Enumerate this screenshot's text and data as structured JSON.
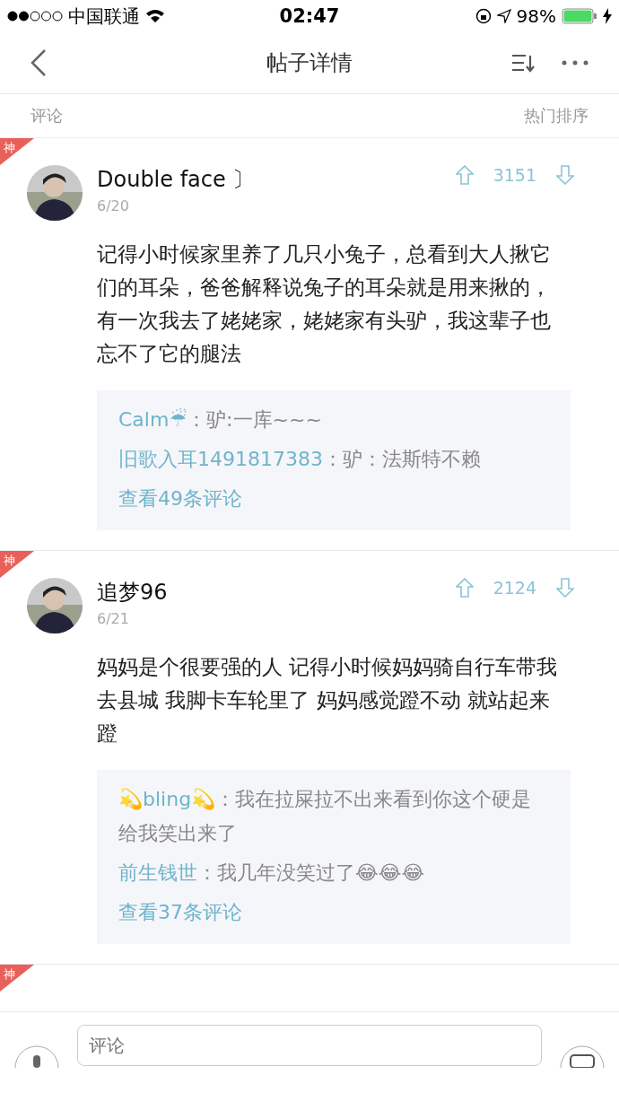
{
  "status_bar": {
    "carrier": "中国联通",
    "time": "02:47",
    "battery": "98%"
  },
  "nav": {
    "title": "帖子详情"
  },
  "section": {
    "title": "评论",
    "sort": "热门排序"
  },
  "comments": [
    {
      "badge": "神",
      "author": "Double  face 〕",
      "date": "6/20",
      "votes": "3151",
      "text": "记得小时候家里养了几只小兔子，总看到大人揪它们的耳朵，爸爸解释说兔子的耳朵就是用来揪的，有一次我去了姥姥家，姥姥家有头驴，我这辈子也忘不了它的腿法",
      "replies": [
        {
          "author": "Calm☔",
          "text": "：驴:一库~~~"
        },
        {
          "author": "旧歌入耳1491817383",
          "text": "：驴：法斯特不赖"
        }
      ],
      "more": "查看49条评论"
    },
    {
      "badge": "神",
      "author": "追梦96",
      "date": "6/21",
      "votes": "2124",
      "text": "妈妈是个很要强的人 记得小时候妈妈骑自行车带我去县城 我脚卡车轮里了 妈妈感觉蹬不动 就站起来蹬",
      "replies": [
        {
          "author": "💫bling💫",
          "text": "：我在拉屎拉不出来看到你这个硬是给我笑出来了"
        },
        {
          "author": "前生钱世",
          "text": "：我几年没笑过了😂😂😂"
        }
      ],
      "more": "查看37条评论"
    },
    {
      "badge": "神"
    }
  ],
  "input": {
    "placeholder": "评论"
  }
}
